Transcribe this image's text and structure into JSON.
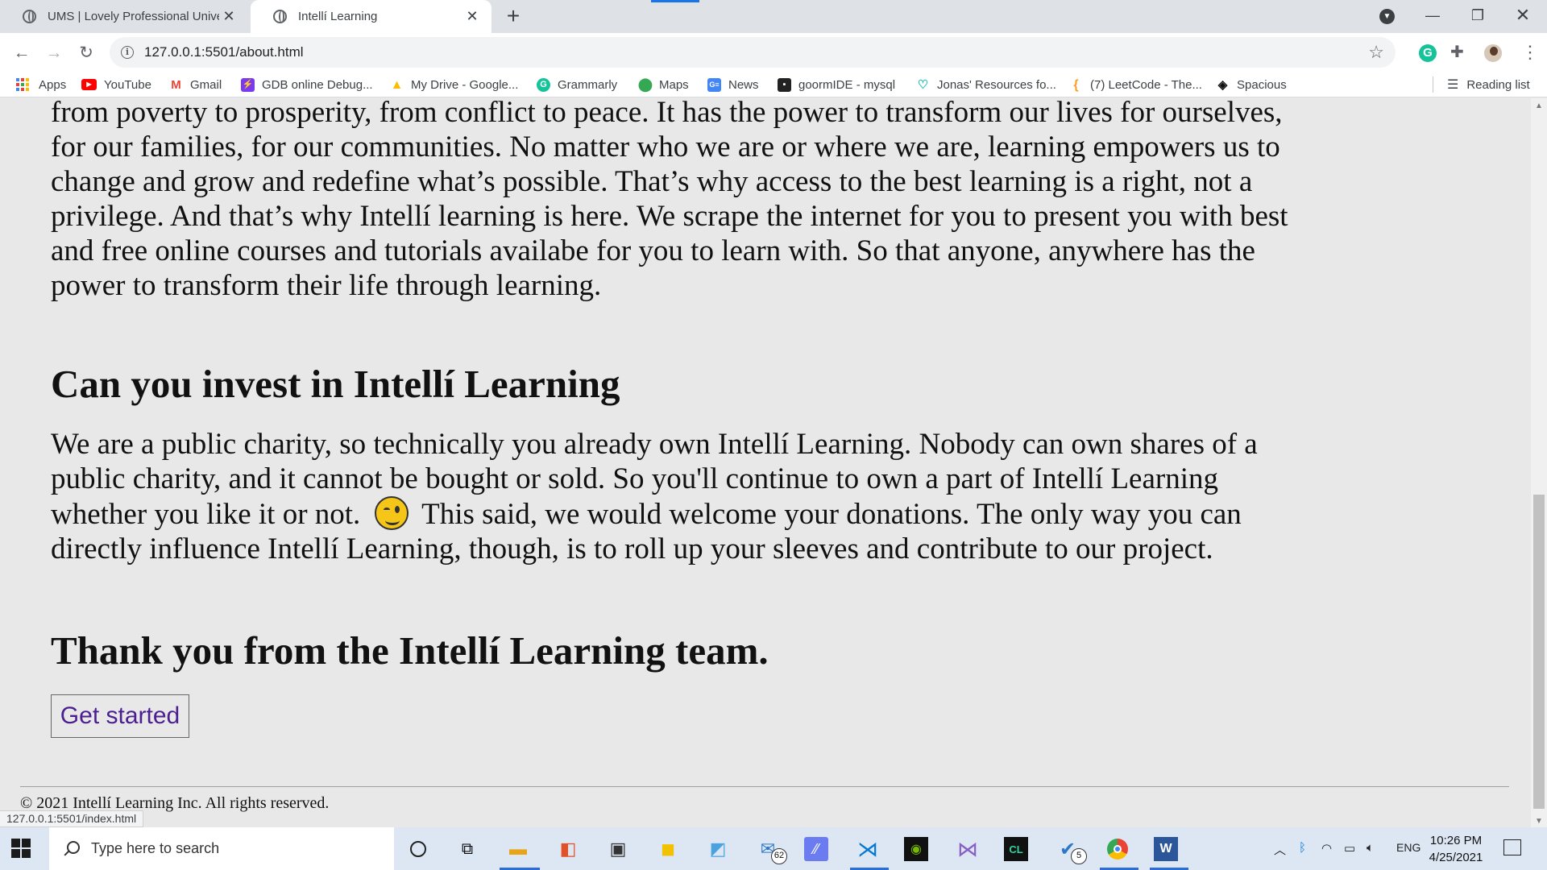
{
  "browser": {
    "tabs": [
      {
        "title": "UMS | Lovely Professional Univer",
        "active": false
      },
      {
        "title": "Intellí Learning",
        "active": true
      }
    ],
    "url": "127.0.0.1:5501/about.html",
    "status_url": "127.0.0.1:5501/index.html",
    "bookmarks": [
      {
        "label": "Apps",
        "icon": "apps-grid-icon"
      },
      {
        "label": "YouTube",
        "icon": "youtube-icon",
        "color": "#ff0000"
      },
      {
        "label": "Gmail",
        "icon": "gmail-icon",
        "color": "#ea4335"
      },
      {
        "label": "GDB online Debug...",
        "icon": "gdb-icon",
        "color": "#7c3aed"
      },
      {
        "label": "My Drive - Google...",
        "icon": "drive-icon",
        "color": "#fbbc04"
      },
      {
        "label": "Grammarly",
        "icon": "grammarly-icon",
        "color": "#15c39a"
      },
      {
        "label": "Maps",
        "icon": "maps-pin-icon",
        "color": "#34a853"
      },
      {
        "label": "News",
        "icon": "news-icon",
        "color": "#4285f4"
      },
      {
        "label": "goormIDE - mysql",
        "icon": "goorm-icon",
        "color": "#222222"
      },
      {
        "label": "Jonas' Resources fo...",
        "icon": "heart-icon",
        "color": "#21c1b6"
      },
      {
        "label": "(7) LeetCode - The...",
        "icon": "leetcode-icon",
        "color": "#f89f1b"
      },
      {
        "label": "Spacious",
        "icon": "spacious-icon",
        "color": "#111111"
      }
    ],
    "reading_list": "Reading list"
  },
  "page": {
    "intro_paragraph": "from poverty to prosperity, from conflict to peace. It has the power to transform our lives for ourselves, for our families, for our communities. No matter who we are or where we are, learning empowers us to change and grow and redefine what’s possible. That’s why access to the best learning is a right, not a privilege. And that’s why Intellí learning is here. We scrape the internet for you to present you with best and free online courses and tutorials availabe for you to learn with. So that anyone, anywhere has the power to transform their life through learning.",
    "invest_heading": "Can you invest in Intellí Learning",
    "invest_paragraph_before": "We are a public charity, so technically you already own Intellí Learning. Nobody can own shares of a public charity, and it cannot be bought or sold. So you'll continue to own a part of Intellí Learning whether you like it or not.",
    "invest_paragraph_after": "This said, we would welcome your donations. The only way you can directly influence Intellí Learning, though, is to roll up your sleeves and contribute to our project.",
    "thanks_heading": "Thank you from the Intellí Learning team.",
    "cta_label": "Get started",
    "footer": "© 2021 Intellí Learning Inc. All rights reserved."
  },
  "taskbar": {
    "search_placeholder": "Type here to search",
    "mail_badge": "62",
    "todo_badge": "5",
    "language": "ENG",
    "time": "10:26 PM",
    "date": "4/25/2021"
  }
}
